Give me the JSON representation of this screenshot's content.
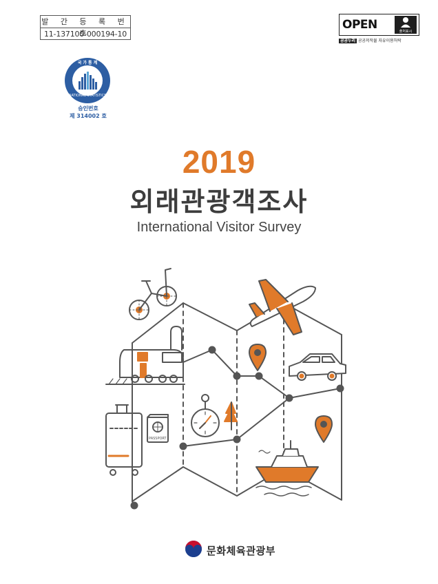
{
  "registration": {
    "label": "발 간 등 록 번 호",
    "number": "11-137100-000194-10"
  },
  "license": {
    "open_text": "OPEN",
    "person_caption": "출처표시",
    "badge_left": "공공누리",
    "badge_right": "공공저작물 자유이용허락"
  },
  "statistics": {
    "seal_top_text": "국 가 통 계",
    "seal_ring_text": "NATIONAL STATISTICS",
    "approval_line1": "승인번호",
    "approval_line2": "제 314002 호"
  },
  "cover": {
    "year": "2019",
    "title_ko": "외래관광객조사",
    "title_en": "International Visitor Survey"
  },
  "illustration": {
    "passport_text": "PASSPORT"
  },
  "publisher": {
    "name": "문화체육관광부"
  },
  "colors": {
    "accent": "#e07a2a",
    "line": "#555555",
    "seal_blue": "#2d5ea3"
  }
}
